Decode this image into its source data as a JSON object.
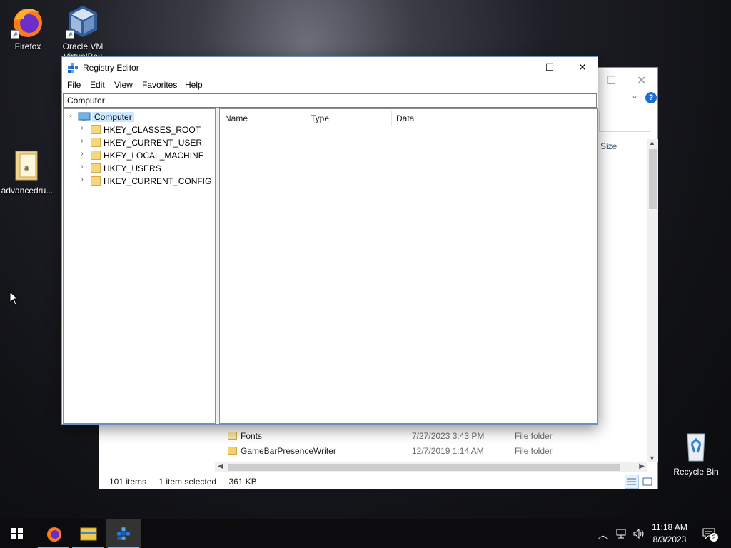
{
  "desktop": {
    "icons": [
      {
        "label": "Firefox",
        "icon": "firefox-icon"
      },
      {
        "label": "Oracle VM VirtualBox",
        "icon": "virtualbox-icon"
      },
      {
        "label": "advancedru...",
        "icon": "file-icon"
      },
      {
        "label": "Recycle Bin",
        "icon": "recycle-bin-icon"
      }
    ]
  },
  "explorer": {
    "columns": {
      "size": "Size"
    },
    "files": [
      {
        "name": "Fonts",
        "date": "7/27/2023 3:43 PM",
        "type": "File folder"
      },
      {
        "name": "GameBarPresenceWriter",
        "date": "12/7/2019 1:14 AM",
        "type": "File folder"
      }
    ],
    "status": {
      "items": "101 items",
      "selected": "1 item selected",
      "size": "361 KB"
    },
    "help_label": "?"
  },
  "regedit": {
    "title": "Registry Editor",
    "window_controls": {
      "minimize": "—",
      "maximize": "☐",
      "close": "✕"
    },
    "menu": [
      "File",
      "Edit",
      "View",
      "Favorites",
      "Help"
    ],
    "address": "Computer",
    "tree": {
      "root": "Computer",
      "children": [
        "HKEY_CLASSES_ROOT",
        "HKEY_CURRENT_USER",
        "HKEY_LOCAL_MACHINE",
        "HKEY_USERS",
        "HKEY_CURRENT_CONFIG"
      ]
    },
    "columns": [
      "Name",
      "Type",
      "Data"
    ]
  },
  "taskbar": {
    "pinned": [
      "start-icon",
      "firefox-icon",
      "file-explorer-icon",
      "registry-editor-icon"
    ],
    "clock": {
      "time": "11:18 AM",
      "date": "8/3/2023"
    },
    "notification_count": "2"
  }
}
